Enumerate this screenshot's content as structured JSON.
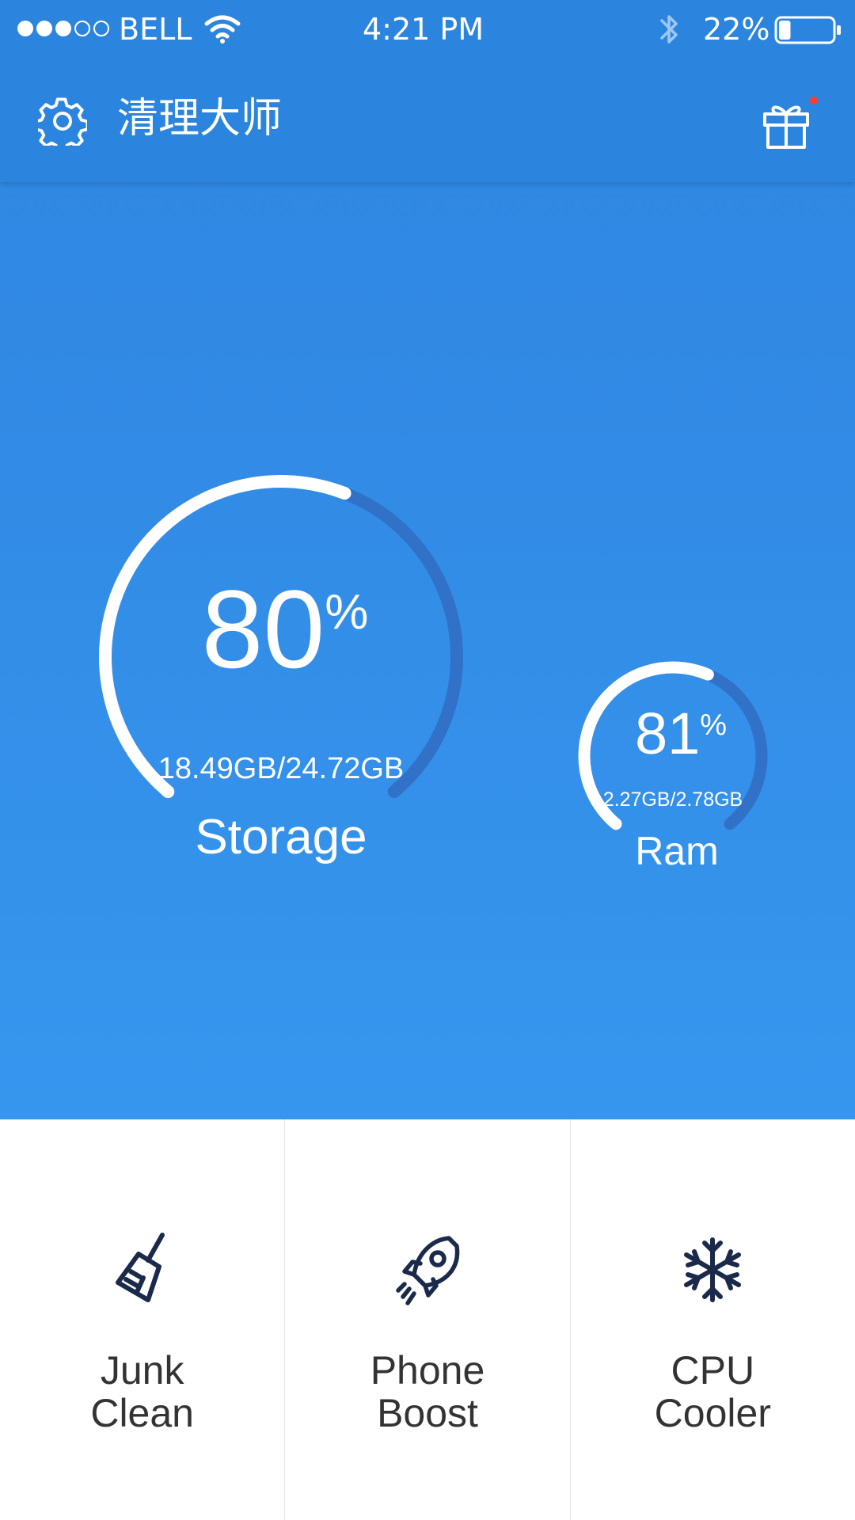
{
  "status_bar": {
    "carrier": "BELL",
    "time": "4:21 PM",
    "battery_percent": "22%",
    "battery_level": 0.22,
    "signal_bars_filled": 3,
    "signal_bars_total": 5
  },
  "app_bar": {
    "title": "清理大师",
    "settings_icon": "gear-icon",
    "gift_icon": "gift-icon",
    "notification_dot_color": "#ff3b30"
  },
  "storage": {
    "percent": "80",
    "percent_sign": "%",
    "usage": "18.49GB/24.72GB",
    "label": "Storage",
    "fill_fraction": 0.8
  },
  "ram": {
    "percent": "81",
    "percent_sign": "%",
    "usage": "2.27GB/2.78GB",
    "label": "Ram",
    "fill_fraction": 0.81
  },
  "tiles": [
    {
      "line1": "Junk",
      "line2": "Clean",
      "icon": "broom-icon"
    },
    {
      "line1": "Phone",
      "line2": "Boost",
      "icon": "rocket-icon"
    },
    {
      "line1": "CPU",
      "line2": "Cooler",
      "icon": "snowflake-icon"
    }
  ],
  "colors": {
    "primary": "#2b84dd",
    "gauge_track": "#2f6fc4",
    "gauge_fill": "#ffffff",
    "icon_dark": "#1b2a4a"
  }
}
